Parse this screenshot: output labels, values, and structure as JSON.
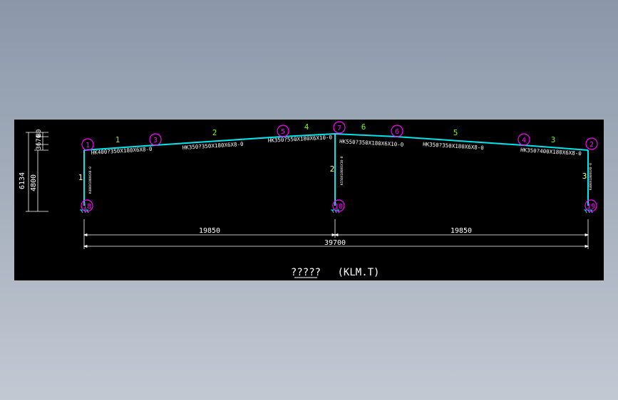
{
  "drawing": {
    "title": "?????",
    "subtitle": "(KLM.T)",
    "colors": {
      "background": "#000000",
      "frame": "#00e5ee",
      "node": "#ff00ff",
      "member_label": "#7cfc00",
      "text": "#ffffff",
      "column_label": "#ffff66"
    },
    "nodes": [
      "1",
      "3",
      "5",
      "7",
      "6",
      "4",
      "2",
      "18",
      "10",
      "19"
    ],
    "member_numbers": [
      "1",
      "2",
      "4",
      "6",
      "5",
      "3"
    ],
    "column_numbers": [
      "1",
      "2",
      "3"
    ],
    "sections": [
      "HK400?350X180X6X8-0",
      "HK350?350X180X6X8-0",
      "HK350?550X180X6X10-0",
      "HK550?350X180X6X10-0",
      "HK350?350X180X6X8-0",
      "HK350?400X180X6X8-0"
    ],
    "column_sections": [
      "K400X180X6X8-0",
      "K550X180X6X10-0",
      "K400X180X6X8-0"
    ],
    "dimensions": {
      "span_left": "19850",
      "span_right": "19850",
      "span_total": "39700",
      "height_total": "6134",
      "height_eave": "4800",
      "height_rise_1": "3",
      "height_rise_2": "676",
      "height_rise_3": "80"
    }
  }
}
